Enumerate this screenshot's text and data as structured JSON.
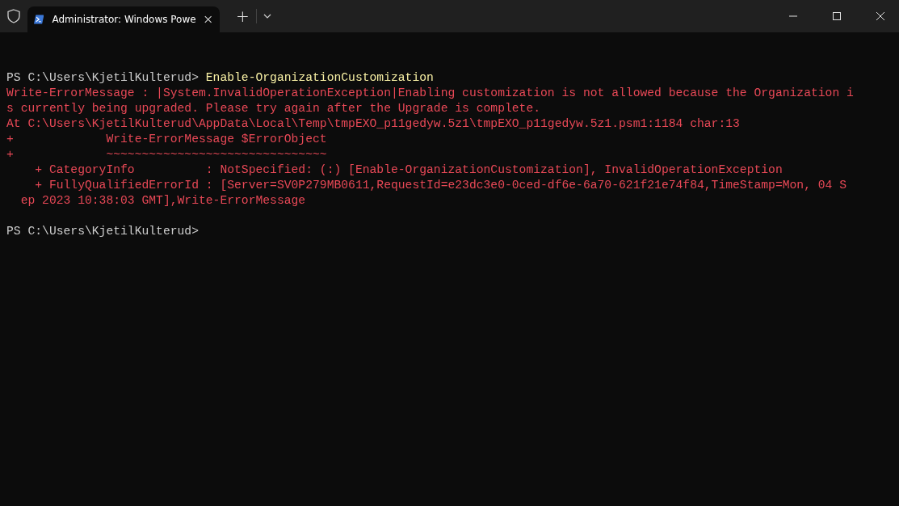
{
  "window": {
    "tab": {
      "title": "Administrator: Windows Powe",
      "selected": true
    },
    "new_tab": "+"
  },
  "lines": [
    {
      "kind": "command",
      "prompt": "PS C:\\Users\\KjetilKulterud> ",
      "text": "Enable-OrganizationCustomization"
    },
    {
      "kind": "error",
      "text": "Write-ErrorMessage : |System.InvalidOperationException|Enabling customization is not allowed because the Organization i"
    },
    {
      "kind": "error",
      "text": "s currently being upgraded. Please try again after the Upgrade is complete."
    },
    {
      "kind": "error",
      "text": "At C:\\Users\\KjetilKulterud\\AppData\\Local\\Temp\\tmpEXO_p11gedyw.5z1\\tmpEXO_p11gedyw.5z1.psm1:1184 char:13"
    },
    {
      "kind": "error",
      "text": "+             Write-ErrorMessage $ErrorObject"
    },
    {
      "kind": "error",
      "text": "+             ~~~~~~~~~~~~~~~~~~~~~~~~~~~~~~~"
    },
    {
      "kind": "error",
      "text": "    + CategoryInfo          : NotSpecified: (:) [Enable-OrganizationCustomization], InvalidOperationException"
    },
    {
      "kind": "error",
      "text": "    + FullyQualifiedErrorId : [Server=SV0P279MB0611,RequestId=e23dc3e0-0ced-df6e-6a70-621f21e74f84,TimeStamp=Mon, 04 S"
    },
    {
      "kind": "error",
      "text": "  ep 2023 10:38:03 GMT],Write-ErrorMessage"
    },
    {
      "kind": "blank"
    },
    {
      "kind": "prompt",
      "prompt": "PS C:\\Users\\KjetilKulterud>"
    }
  ]
}
